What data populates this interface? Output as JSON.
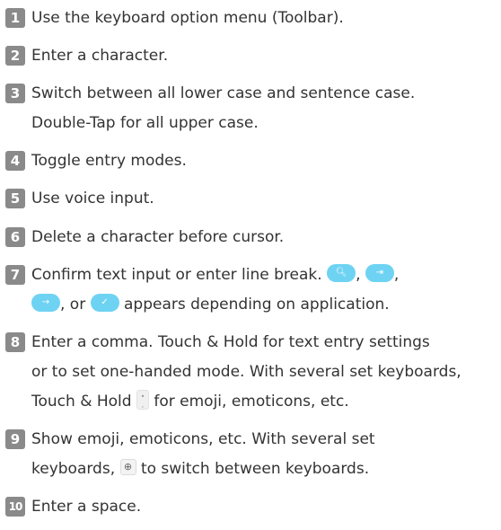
{
  "items": [
    {
      "num": "1",
      "lines": [
        "Use the keyboard option menu (Toolbar)."
      ]
    },
    {
      "num": "2",
      "lines": [
        "Enter a character."
      ]
    },
    {
      "num": "3",
      "lines": [
        "Switch between all lower case and sentence case.",
        "Double-Tap for all upper case."
      ]
    },
    {
      "num": "4",
      "lines": [
        "Toggle entry modes."
      ]
    },
    {
      "num": "5",
      "lines": [
        "Use voice input."
      ]
    },
    {
      "num": "6",
      "lines": [
        "Delete a character before cursor."
      ]
    },
    {
      "num": "7",
      "line1": "Confirm text input or enter line break.",
      "sep1": ",",
      "sep2": ",",
      "sep3": ", or",
      "line2_tail": "appears depending on application."
    },
    {
      "num": "8",
      "lines": [
        "Enter a comma. Touch & Hold for text entry settings",
        "or to set one-handed mode. With several set keyboards,"
      ],
      "line3_head": "Touch & Hold",
      "line3_tail": "for emoji, emoticons, etc."
    },
    {
      "num": "9",
      "line1": "Show emoji, emoticons, etc. With several set",
      "line2_head": "keyboards,",
      "line2_tail": "to switch between keyboards."
    },
    {
      "num": "10",
      "lines": [
        "Enter a space."
      ]
    }
  ],
  "icons": {
    "search": "search-key-icon",
    "tab": "tab-key-icon",
    "next": "next-key-icon",
    "done": "done-key-icon",
    "mic_comma": "mic-comma-key-icon",
    "globe": "globe-key-icon"
  },
  "colors": {
    "badge": "#8a8a8a",
    "key_blue": "#6ed3f2",
    "text": "#333333"
  }
}
